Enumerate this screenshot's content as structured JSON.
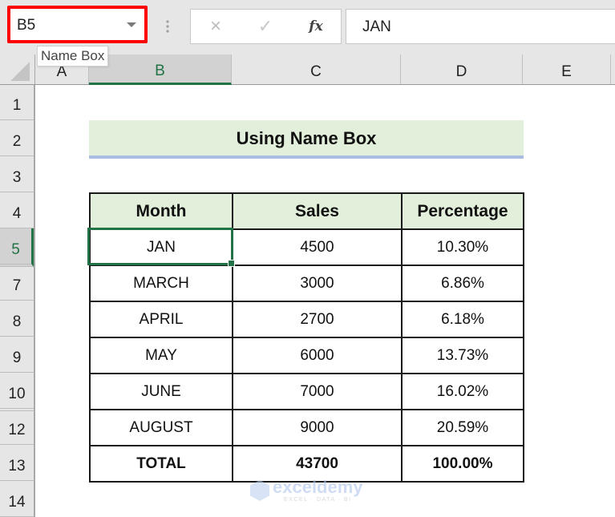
{
  "formula_bar": {
    "name_box_value": "B5",
    "name_box_tooltip": "Name Box",
    "cancel_icon": "×",
    "enter_icon": "✓",
    "fx_label": "fx",
    "formula_value": "JAN"
  },
  "highlight_color": "#ff0000",
  "accent_color": "#217346",
  "columns": [
    {
      "label": "A",
      "selected": false
    },
    {
      "label": "B",
      "selected": true
    },
    {
      "label": "C",
      "selected": false
    },
    {
      "label": "D",
      "selected": false
    },
    {
      "label": "E",
      "selected": false
    }
  ],
  "rows": [
    {
      "label": "1"
    },
    {
      "label": "2"
    },
    {
      "label": "3"
    },
    {
      "label": "4"
    },
    {
      "label": "5",
      "selected": true,
      "hidden_after": true
    },
    {
      "label": "7"
    },
    {
      "label": "8"
    },
    {
      "label": "9"
    },
    {
      "label": "10",
      "hidden_after": true
    },
    {
      "label": "12"
    },
    {
      "label": "13"
    },
    {
      "label": "14"
    }
  ],
  "sheet": {
    "title": "Using Name Box",
    "table": {
      "headers": [
        "Month",
        "Sales",
        "Percentage"
      ],
      "rows": [
        [
          "JAN",
          "4500",
          "10.30%"
        ],
        [
          "MARCH",
          "3000",
          "6.86%"
        ],
        [
          "APRIL",
          "2700",
          "6.18%"
        ],
        [
          "MAY",
          "6000",
          "13.73%"
        ],
        [
          "JUNE",
          "7000",
          "16.02%"
        ],
        [
          "AUGUST",
          "9000",
          "20.59%"
        ]
      ],
      "total": [
        "TOTAL",
        "43700",
        "100.00%"
      ]
    },
    "selected_cell": "B5"
  },
  "watermark": {
    "brand": "exceldemy",
    "tagline": "EXCEL · DATA · BI"
  }
}
